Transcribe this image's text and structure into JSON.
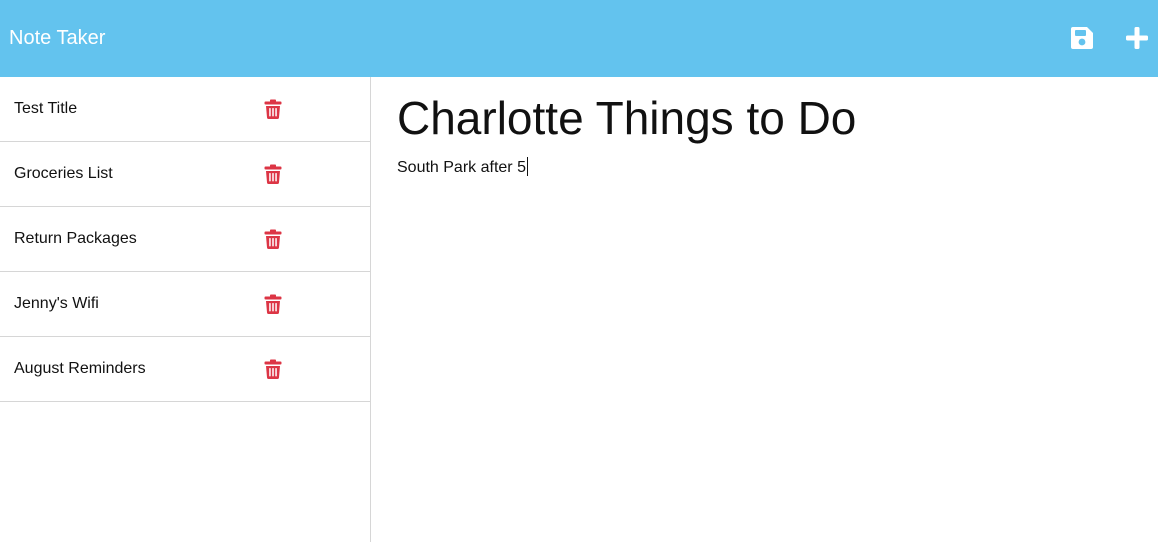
{
  "navbar": {
    "brand": "Note Taker",
    "save_icon": "floppy-disk-save-icon",
    "new_icon": "plus-icon",
    "background_color": "#63c3ee"
  },
  "sidebar": {
    "notes": [
      {
        "title": "Test Title",
        "delete_icon": "trash-icon"
      },
      {
        "title": "Groceries List",
        "delete_icon": "trash-icon"
      },
      {
        "title": "Return Packages",
        "delete_icon": "trash-icon"
      },
      {
        "title": "Jenny's Wifi",
        "delete_icon": "trash-icon"
      },
      {
        "title": "August Reminders",
        "delete_icon": "trash-icon"
      }
    ],
    "delete_color": "#dc3545"
  },
  "editor": {
    "title": "Charlotte Things to Do",
    "text": "South Park after 5"
  }
}
